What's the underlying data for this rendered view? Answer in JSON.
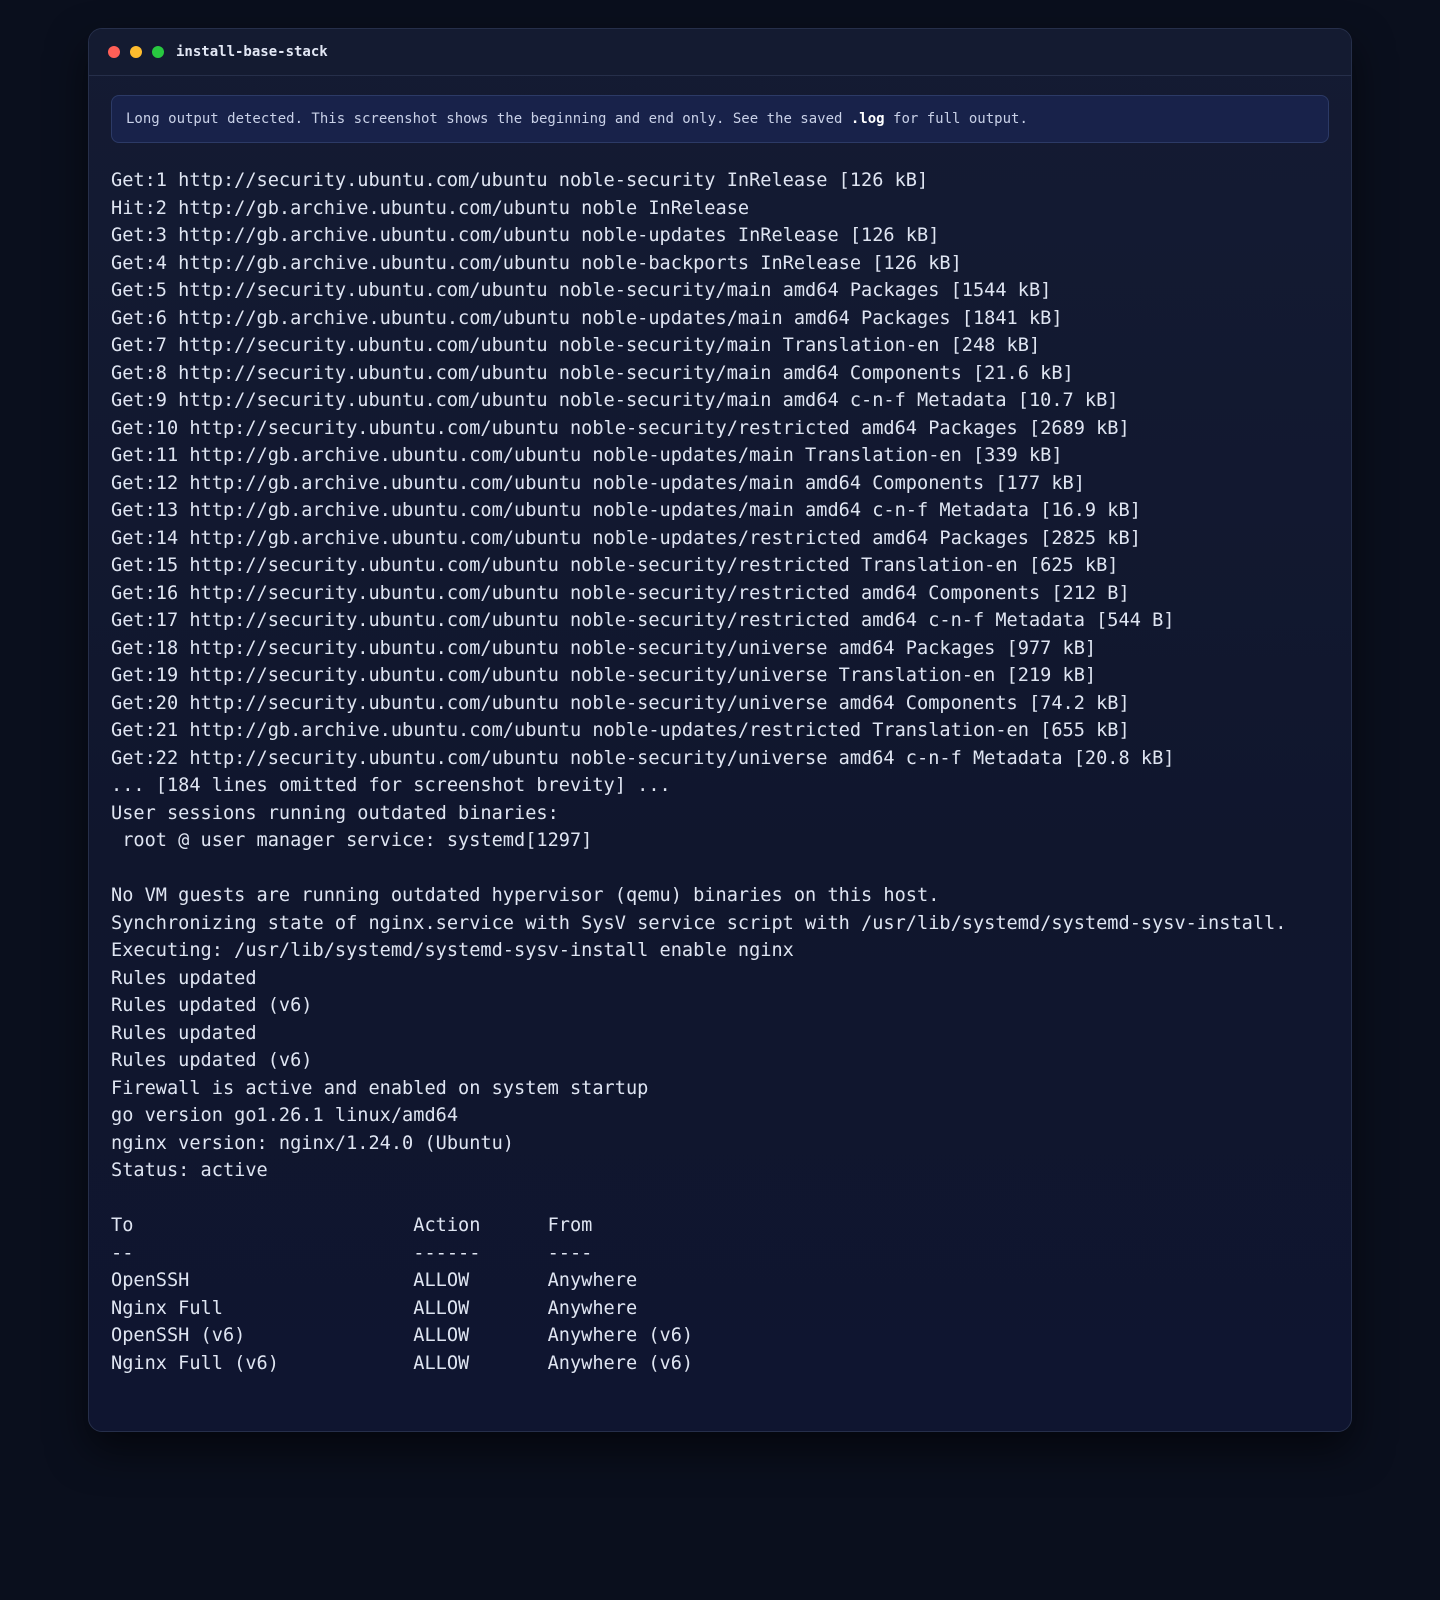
{
  "window": {
    "title": "install-base-stack"
  },
  "notice": {
    "prefix": "Long output detected. This screenshot shows the beginning and end only. See the saved ",
    "highlight": ".log",
    "suffix": " for full output."
  },
  "output_lines": [
    "Get:1 http://security.ubuntu.com/ubuntu noble-security InRelease [126 kB]",
    "Hit:2 http://gb.archive.ubuntu.com/ubuntu noble InRelease",
    "Get:3 http://gb.archive.ubuntu.com/ubuntu noble-updates InRelease [126 kB]",
    "Get:4 http://gb.archive.ubuntu.com/ubuntu noble-backports InRelease [126 kB]",
    "Get:5 http://security.ubuntu.com/ubuntu noble-security/main amd64 Packages [1544 kB]",
    "Get:6 http://gb.archive.ubuntu.com/ubuntu noble-updates/main amd64 Packages [1841 kB]",
    "Get:7 http://security.ubuntu.com/ubuntu noble-security/main Translation-en [248 kB]",
    "Get:8 http://security.ubuntu.com/ubuntu noble-security/main amd64 Components [21.6 kB]",
    "Get:9 http://security.ubuntu.com/ubuntu noble-security/main amd64 c-n-f Metadata [10.7 kB]",
    "Get:10 http://security.ubuntu.com/ubuntu noble-security/restricted amd64 Packages [2689 kB]",
    "Get:11 http://gb.archive.ubuntu.com/ubuntu noble-updates/main Translation-en [339 kB]",
    "Get:12 http://gb.archive.ubuntu.com/ubuntu noble-updates/main amd64 Components [177 kB]",
    "Get:13 http://gb.archive.ubuntu.com/ubuntu noble-updates/main amd64 c-n-f Metadata [16.9 kB]",
    "Get:14 http://gb.archive.ubuntu.com/ubuntu noble-updates/restricted amd64 Packages [2825 kB]",
    "Get:15 http://security.ubuntu.com/ubuntu noble-security/restricted Translation-en [625 kB]",
    "Get:16 http://security.ubuntu.com/ubuntu noble-security/restricted amd64 Components [212 B]",
    "Get:17 http://security.ubuntu.com/ubuntu noble-security/restricted amd64 c-n-f Metadata [544 B]",
    "Get:18 http://security.ubuntu.com/ubuntu noble-security/universe amd64 Packages [977 kB]",
    "Get:19 http://security.ubuntu.com/ubuntu noble-security/universe Translation-en [219 kB]",
    "Get:20 http://security.ubuntu.com/ubuntu noble-security/universe amd64 Components [74.2 kB]",
    "Get:21 http://gb.archive.ubuntu.com/ubuntu noble-updates/restricted Translation-en [655 kB]",
    "Get:22 http://security.ubuntu.com/ubuntu noble-security/universe amd64 c-n-f Metadata [20.8 kB]",
    "... [184 lines omitted for screenshot brevity] ...",
    "User sessions running outdated binaries:",
    " root @ user manager service: systemd[1297]",
    "",
    "No VM guests are running outdated hypervisor (qemu) binaries on this host.",
    "Synchronizing state of nginx.service with SysV service script with /usr/lib/systemd/systemd-sysv-install.",
    "Executing: /usr/lib/systemd/systemd-sysv-install enable nginx",
    "Rules updated",
    "Rules updated (v6)",
    "Rules updated",
    "Rules updated (v6)",
    "Firewall is active and enabled on system startup",
    "go version go1.26.1 linux/amd64",
    "nginx version: nginx/1.24.0 (Ubuntu)",
    "Status: active",
    "",
    "To                         Action      From",
    "--                         ------      ----",
    "OpenSSH                    ALLOW       Anywhere",
    "Nginx Full                 ALLOW       Anywhere",
    "OpenSSH (v6)               ALLOW       Anywhere (v6)",
    "Nginx Full (v6)            ALLOW       Anywhere (v6)"
  ]
}
